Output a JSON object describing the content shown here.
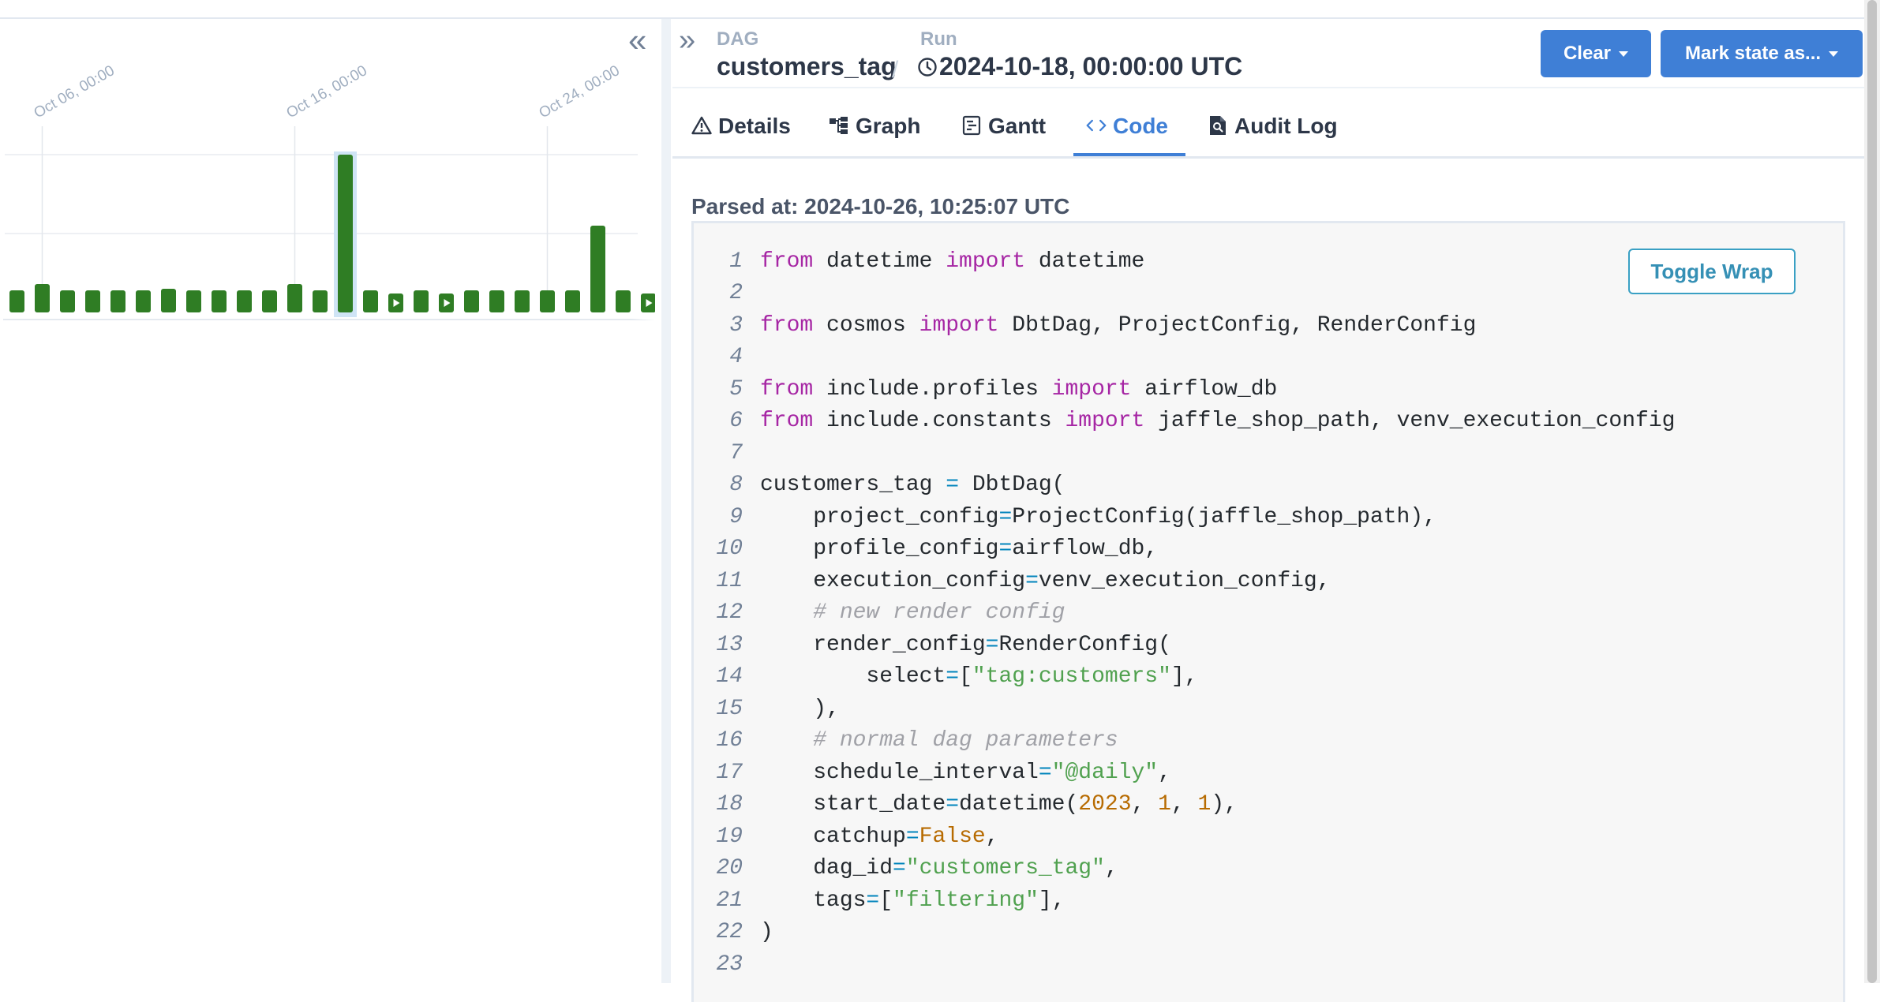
{
  "sidebar_toggle": {
    "collapse_glyph": "«",
    "expand_glyph": "»"
  },
  "chart_data": {
    "type": "bar",
    "x_tick_labels": [
      "Oct 06, 00:00",
      "Oct 16, 00:00",
      "Oct 24, 00:00"
    ],
    "bars": [
      {
        "value": 14,
        "state": "success"
      },
      {
        "value": 18,
        "state": "success"
      },
      {
        "value": 14,
        "state": "success"
      },
      {
        "value": 14,
        "state": "success"
      },
      {
        "value": 14,
        "state": "success"
      },
      {
        "value": 14,
        "state": "success"
      },
      {
        "value": 15,
        "state": "success"
      },
      {
        "value": 14,
        "state": "success"
      },
      {
        "value": 14,
        "state": "success"
      },
      {
        "value": 14,
        "state": "success"
      },
      {
        "value": 14,
        "state": "success"
      },
      {
        "value": 18,
        "state": "success"
      },
      {
        "value": 14,
        "state": "success"
      },
      {
        "value": 100,
        "state": "success",
        "selected": true
      },
      {
        "value": 14,
        "state": "success"
      },
      {
        "value": 12,
        "state": "success",
        "play": true
      },
      {
        "value": 14,
        "state": "success"
      },
      {
        "value": 12,
        "state": "success",
        "play": true
      },
      {
        "value": 14,
        "state": "success"
      },
      {
        "value": 14,
        "state": "success"
      },
      {
        "value": 14,
        "state": "success"
      },
      {
        "value": 14,
        "state": "success"
      },
      {
        "value": 14,
        "state": "success"
      },
      {
        "value": 55,
        "state": "success"
      },
      {
        "value": 14,
        "state": "success"
      },
      {
        "value": 12,
        "state": "success",
        "play": true
      }
    ],
    "bar_color": "#2f7d24",
    "grid": true
  },
  "header": {
    "dag_label": "DAG",
    "dag_value": "customers_tag",
    "separator": "/",
    "run_label": "Run",
    "run_value": "2024-10-18, 00:00:00 UTC",
    "clear_button": "Clear",
    "mark_state_button": "Mark state as...",
    "accent_color": "#3f7fd6"
  },
  "tabs": [
    {
      "label": "Details",
      "icon": "warning-triangle-icon"
    },
    {
      "label": "Graph",
      "icon": "graph-icon"
    },
    {
      "label": "Gantt",
      "icon": "gantt-icon"
    },
    {
      "label": "Code",
      "icon": "code-icon",
      "active": true
    },
    {
      "label": "Audit Log",
      "icon": "document-search-icon"
    }
  ],
  "parsed_at": "Parsed at: 2024-10-26, 10:25:07 UTC",
  "toggle_wrap": "Toggle Wrap",
  "code": [
    [
      [
        "kw",
        "from"
      ],
      [
        "t",
        " datetime "
      ],
      [
        "kw",
        "import"
      ],
      [
        "t",
        " datetime"
      ]
    ],
    [],
    [
      [
        "kw",
        "from"
      ],
      [
        "t",
        " cosmos "
      ],
      [
        "kw",
        "import"
      ],
      [
        "t",
        " DbtDag, ProjectConfig, RenderConfig"
      ]
    ],
    [],
    [
      [
        "kw",
        "from"
      ],
      [
        "t",
        " include.profiles "
      ],
      [
        "kw",
        "import"
      ],
      [
        "t",
        " airflow_db"
      ]
    ],
    [
      [
        "kw",
        "from"
      ],
      [
        "t",
        " include.constants "
      ],
      [
        "kw",
        "import"
      ],
      [
        "t",
        " jaffle_shop_path, venv_execution_config"
      ]
    ],
    [],
    [
      [
        "t",
        "customers_tag "
      ],
      [
        "op",
        "="
      ],
      [
        "t",
        " DbtDag("
      ]
    ],
    [
      [
        "t",
        "    project_config"
      ],
      [
        "op",
        "="
      ],
      [
        "t",
        "ProjectConfig(jaffle_shop_path),"
      ]
    ],
    [
      [
        "t",
        "    profile_config"
      ],
      [
        "op",
        "="
      ],
      [
        "t",
        "airflow_db,"
      ]
    ],
    [
      [
        "t",
        "    execution_config"
      ],
      [
        "op",
        "="
      ],
      [
        "t",
        "venv_execution_config,"
      ]
    ],
    [
      [
        "t",
        "    "
      ],
      [
        "cmt",
        "# new render config"
      ]
    ],
    [
      [
        "t",
        "    render_config"
      ],
      [
        "op",
        "="
      ],
      [
        "t",
        "RenderConfig("
      ]
    ],
    [
      [
        "t",
        "        select"
      ],
      [
        "op",
        "="
      ],
      [
        "t",
        "["
      ],
      [
        "str",
        "\"tag:customers\""
      ],
      [
        "t",
        "],"
      ]
    ],
    [
      [
        "t",
        "    ),"
      ]
    ],
    [
      [
        "t",
        "    "
      ],
      [
        "cmt",
        "# normal dag parameters"
      ]
    ],
    [
      [
        "t",
        "    schedule_interval"
      ],
      [
        "op",
        "="
      ],
      [
        "str",
        "\"@daily\""
      ],
      [
        "t",
        ","
      ]
    ],
    [
      [
        "t",
        "    start_date"
      ],
      [
        "op",
        "="
      ],
      [
        "t",
        "datetime("
      ],
      [
        "num",
        "2023"
      ],
      [
        "t",
        ", "
      ],
      [
        "num",
        "1"
      ],
      [
        "t",
        ", "
      ],
      [
        "num",
        "1"
      ],
      [
        "t",
        "),"
      ]
    ],
    [
      [
        "t",
        "    catchup"
      ],
      [
        "op",
        "="
      ],
      [
        "num",
        "False"
      ],
      [
        "t",
        ","
      ]
    ],
    [
      [
        "t",
        "    dag_id"
      ],
      [
        "op",
        "="
      ],
      [
        "str",
        "\"customers_tag\""
      ],
      [
        "t",
        ","
      ]
    ],
    [
      [
        "t",
        "    tags"
      ],
      [
        "op",
        "="
      ],
      [
        "t",
        "["
      ],
      [
        "str",
        "\"filtering\""
      ],
      [
        "t",
        "],"
      ]
    ],
    [
      [
        "t",
        ")"
      ]
    ],
    []
  ]
}
